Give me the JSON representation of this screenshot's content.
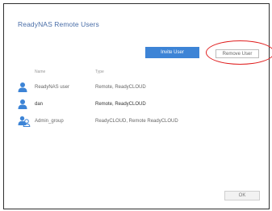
{
  "dialog": {
    "title": "ReadyNAS Remote Users"
  },
  "toolbar": {
    "invite_label": "Invite User",
    "remove_label": "Remove User"
  },
  "table": {
    "columns": [
      "Name",
      "Type"
    ],
    "rows": [
      {
        "name": "ReadyNAS user",
        "type": "Remote, ReadyCLOUD",
        "icon": "user-icon"
      },
      {
        "name": "dan",
        "type": "Remote, ReadyCLOUD",
        "icon": "user-icon"
      },
      {
        "name": "Admin_group",
        "type": "ReadyCLOUD, Remote ReadyCLOUD",
        "icon": "group-icon"
      }
    ]
  },
  "footer": {
    "ok_label": "OK"
  },
  "colors": {
    "accent": "#3d84d6",
    "highlight": "#e02020",
    "title": "#4a6ea8"
  }
}
